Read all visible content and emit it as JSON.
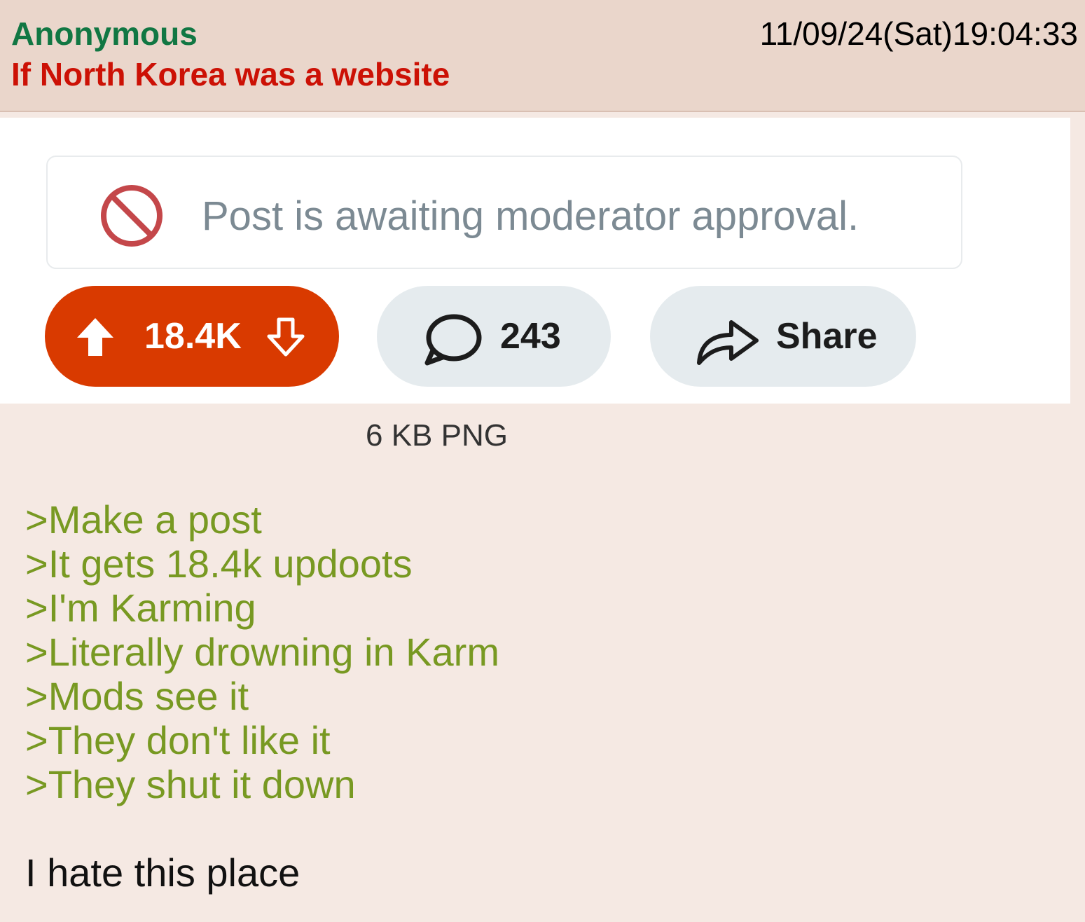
{
  "post": {
    "name": "Anonymous",
    "subject": "If North Korea was a website",
    "datetime": "11/09/24(Sat)19:04:33",
    "file_info": "6 KB PNG",
    "greentext": [
      ">Make a post",
      ">It gets 18.4k updoots",
      ">I'm Karming",
      ">Literally drowning in Karm",
      ">Mods see it",
      ">They don't like it",
      ">They shut it down"
    ],
    "closing_line": "I hate this place"
  },
  "embed": {
    "notice_text": "Post is awaiting moderator approval.",
    "notice_icon": "prohibited-icon",
    "vote_count": "18.4K",
    "upvote_icon": "upvote-arrow-icon",
    "downvote_icon": "downvote-arrow-icon",
    "comment_count": "243",
    "comment_icon": "comment-bubble-icon",
    "share_label": "Share",
    "share_icon": "share-arrow-icon"
  },
  "colors": {
    "background": "#f5e9e3",
    "header": "#ead6cb",
    "name": "#117743",
    "subject": "#cc1105",
    "greentext": "#789922",
    "vote_pill": "#d93a00",
    "neutral_pill": "#e5ebee",
    "notice_icon": "#c4474a"
  }
}
